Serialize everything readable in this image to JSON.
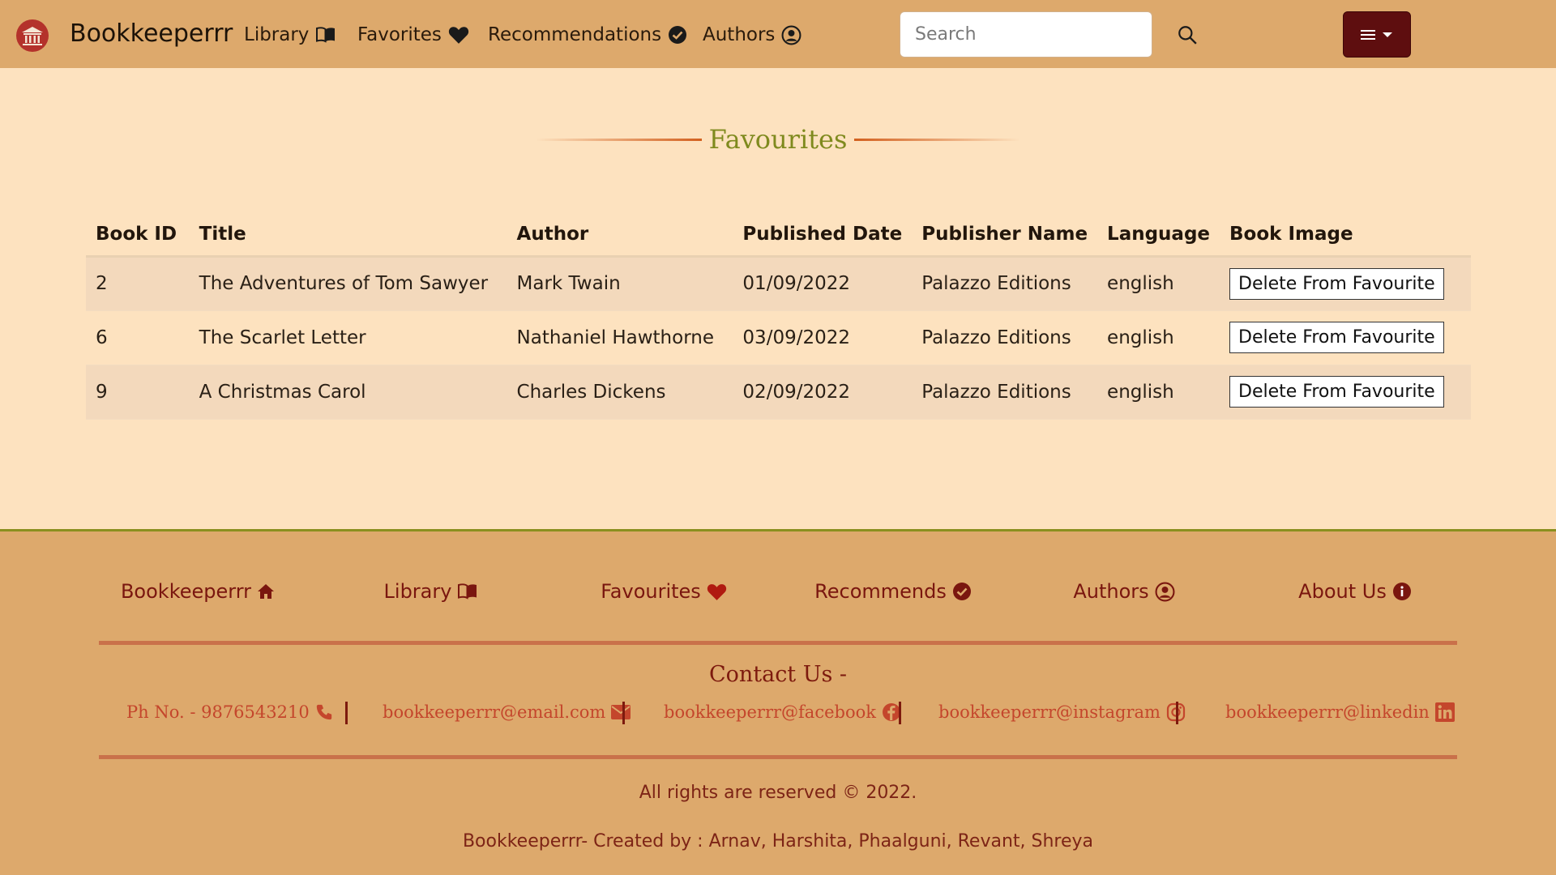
{
  "navbar": {
    "brand": "Bookkeeperrr",
    "links": [
      {
        "label": "Library",
        "icon": "book-open-icon"
      },
      {
        "label": "Favorites",
        "icon": "heart-icon"
      },
      {
        "label": "Recommendations",
        "icon": "check-circle-icon"
      },
      {
        "label": "Authors",
        "icon": "user-circle-icon"
      }
    ],
    "search_placeholder": "Search",
    "menu_icon": "hamburger-icon",
    "colors": {
      "bar": "#dda96c",
      "menu_button": "#5e0e0f"
    }
  },
  "page": {
    "heading": "Favourites",
    "background": "#fde2bf",
    "heading_color": "#7f8a1e"
  },
  "table": {
    "headers": [
      "Book ID",
      "Title",
      "Author",
      "Published Date",
      "Publisher Name",
      "Language",
      "Book Image"
    ],
    "rows": [
      {
        "id": "2",
        "title": "The Adventures of Tom Sawyer",
        "author": "Mark Twain",
        "published": "01/09/2022",
        "publisher": "Palazzo Editions",
        "language": "english",
        "action": "Delete From Favourite"
      },
      {
        "id": "6",
        "title": "The Scarlet Letter",
        "author": "Nathaniel Hawthorne",
        "published": "03/09/2022",
        "publisher": "Palazzo Editions",
        "language": "english",
        "action": "Delete From Favourite"
      },
      {
        "id": "9",
        "title": "A Christmas Carol",
        "author": "Charles Dickens",
        "published": "02/09/2022",
        "publisher": "Palazzo Editions",
        "language": "english",
        "action": "Delete From Favourite"
      }
    ]
  },
  "footer": {
    "links": [
      {
        "label": "Bookkeeperrr",
        "icon": "home-icon"
      },
      {
        "label": "Library",
        "icon": "book-open-icon"
      },
      {
        "label": "Favourites",
        "icon": "heart-icon"
      },
      {
        "label": "Recommends",
        "icon": "check-circle-icon"
      },
      {
        "label": "Authors",
        "icon": "user-circle-icon"
      },
      {
        "label": "About Us",
        "icon": "info-icon"
      }
    ],
    "contact_title": "Contact Us -",
    "contacts": [
      {
        "label": "Ph No. - 9876543210",
        "icon": "phone-icon"
      },
      {
        "label": "bookkeeperrr@email.com",
        "icon": "envelope-icon"
      },
      {
        "label": "bookkeeperrr@facebook",
        "icon": "facebook-icon"
      },
      {
        "label": "bookkeeperrr@instagram",
        "icon": "instagram-icon"
      },
      {
        "label": "bookkeeperrr@linkedin",
        "icon": "linkedin-icon"
      }
    ],
    "rights": "All rights are reserved © 2022.",
    "credits": "Bookkeeperrr- Created by : Arnav, Harshita, Phaalguni, Revant, Shreya",
    "colors": {
      "background": "#dda96c",
      "link": "#7a160f",
      "contact": "#c4462c",
      "top_border": "#8a8f1f"
    }
  }
}
